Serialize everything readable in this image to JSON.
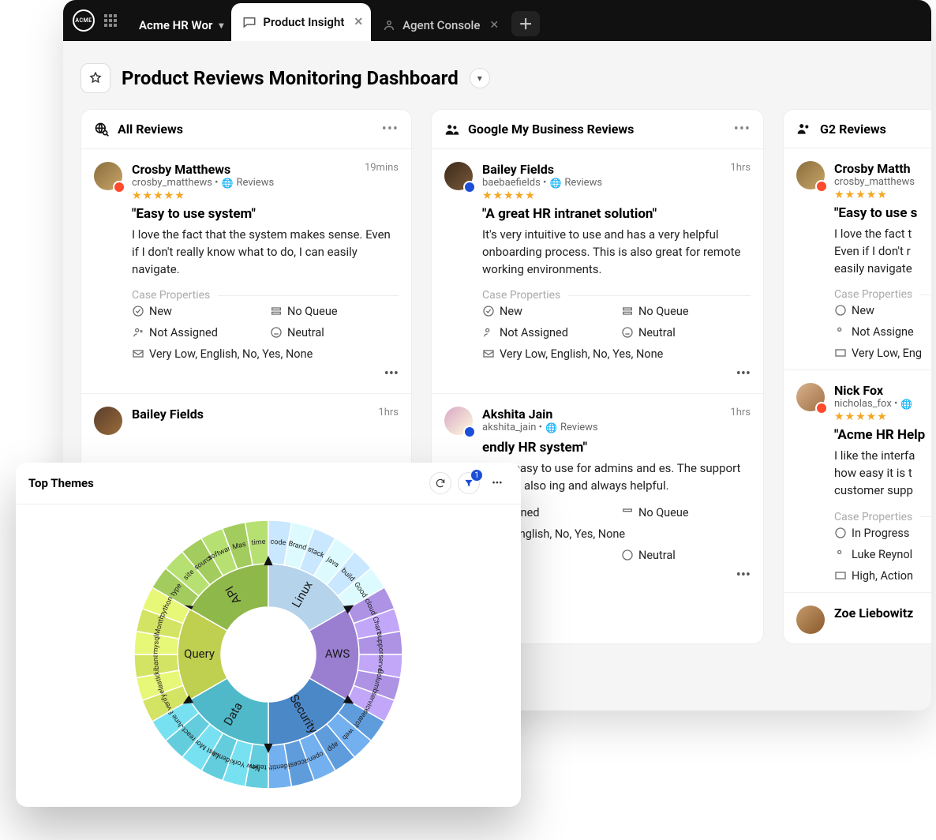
{
  "tabs": {
    "workspace": "Acme HR Wor",
    "active": "Product Insight",
    "third": "Agent Console"
  },
  "page_title": "Product Reviews Monitoring Dashboard",
  "columns": [
    {
      "title": "All Reviews"
    },
    {
      "title": "Google My Business Reviews"
    },
    {
      "title": "G2 Reviews"
    }
  ],
  "labels": {
    "case_properties": "Case Properties",
    "reviews_src": "Reviews"
  },
  "reviews": {
    "crosby": {
      "name": "Crosby Matthews",
      "handle": "crosby_matthews •",
      "time": "19mins",
      "title": "\"Easy to use system\"",
      "body": "I love the fact that the system makes sense. Even if I don't really know what to do, I can easily navigate.",
      "p_status": "New",
      "p_queue": "No Queue",
      "p_assign": "Not Assigned",
      "p_sent": "Neutral",
      "p_meta": "Very Low, English, No, Yes, None"
    },
    "bailey_short": {
      "name": "Bailey Fields",
      "time": "1hrs"
    },
    "bailey": {
      "name": "Bailey Fields",
      "handle": "baebaefields •",
      "time": "1hrs",
      "title": "\"A great HR intranet solution\"",
      "body": "It's very intuitive to use and has a very helpful onboarding process.  This is also great for remote working environments.",
      "p_status": "New",
      "p_queue": "No Queue",
      "p_assign": "Not Assigned",
      "p_sent": "Neutral",
      "p_meta": "Very Low, English, No, Yes, None"
    },
    "akshita": {
      "name": "Akshita Jain",
      "handle": "akshita_jain •",
      "time": "1hrs",
      "title": "endly HR system\"",
      "body": "em is easy to use for admins and es.  The support team is also ing and always helpful.",
      "p_assign": "ssigned",
      "p_queue": "No Queue",
      "p_sent": "Neutral",
      "p_meta": "w, English, No, Yes, None"
    },
    "crosby2": {
      "name": "Crosby Matth",
      "handle": "crosby_matthews",
      "title": "\"Easy to use s",
      "body": "I love the fact t\nEven if I don't r\neasily navigate",
      "p_status": "New",
      "p_assign": "Not Assigne",
      "p_meta": "Very Low, Eng"
    },
    "nick": {
      "name": "Nick Fox",
      "handle": "nicholas_fox •",
      "title": "\"Acme HR Help",
      "body": "I like the interfa\nhow easy it is t\ncustomer supp",
      "p_status": "In Progress",
      "p_assign": "Luke Reynol",
      "p_meta": "High, Action"
    },
    "zoe": {
      "name": "Zoe Liebowitz"
    }
  },
  "panel": {
    "title": "Top Themes",
    "filter_count": "1"
  },
  "chart_data": {
    "type": "sunburst",
    "title": "Top Themes",
    "inner_ring": [
      {
        "label": "API",
        "color": "#8fb84a"
      },
      {
        "label": "Linux",
        "color": "#b5d3ea"
      },
      {
        "label": "AWS",
        "color": "#9a7fd1"
      },
      {
        "label": "Security",
        "color": "#4b88c8"
      },
      {
        "label": "Data",
        "color": "#4fb9c9"
      },
      {
        "label": "Query",
        "color": "#bfcf4f"
      }
    ],
    "outer_ring": [
      {
        "parent": "API",
        "label": "type"
      },
      {
        "parent": "API",
        "label": "site"
      },
      {
        "parent": "API",
        "label": "source"
      },
      {
        "parent": "API",
        "label": "software"
      },
      {
        "parent": "API",
        "label": "Mas"
      },
      {
        "parent": "API",
        "label": "time"
      },
      {
        "parent": "Linux",
        "label": "code"
      },
      {
        "parent": "Linux",
        "label": "Brand"
      },
      {
        "parent": "Linux",
        "label": "stack"
      },
      {
        "parent": "Linux",
        "label": "java"
      },
      {
        "parent": "Linux",
        "label": "build"
      },
      {
        "parent": "Linux",
        "label": "Good"
      },
      {
        "parent": "AWS",
        "label": "cloud"
      },
      {
        "parent": "AWS",
        "label": "Chart"
      },
      {
        "parent": "AWS",
        "label": "support"
      },
      {
        "parent": "AWS",
        "label": "server"
      },
      {
        "parent": "AWS",
        "label": "Columbia"
      },
      {
        "parent": "AWS",
        "label": "service"
      },
      {
        "parent": "Security",
        "label": "search"
      },
      {
        "parent": "Security",
        "label": "web"
      },
      {
        "parent": "Security",
        "label": "app"
      },
      {
        "parent": "Security",
        "label": "open"
      },
      {
        "parent": "Security",
        "label": "access"
      },
      {
        "parent": "Security",
        "label": "identity"
      },
      {
        "parent": "Data",
        "label": "team"
      },
      {
        "parent": "Data",
        "label": "New York City"
      },
      {
        "parent": "Data",
        "label": "identity"
      },
      {
        "parent": "Data",
        "label": "Last Month"
      },
      {
        "parent": "Data",
        "label": "react"
      },
      {
        "parent": "Data",
        "label": "June 8"
      },
      {
        "parent": "Query",
        "label": "verify"
      },
      {
        "parent": "Query",
        "label": "elastic"
      },
      {
        "parent": "Query",
        "label": "kibana"
      },
      {
        "parent": "Query",
        "label": "mysql"
      },
      {
        "parent": "Query",
        "label": "Month"
      },
      {
        "parent": "Query",
        "label": "python"
      }
    ]
  }
}
